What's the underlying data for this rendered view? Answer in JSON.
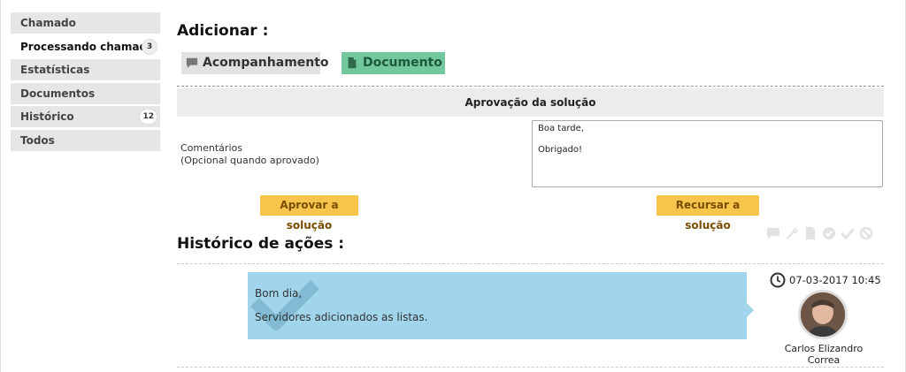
{
  "sidebar": {
    "items": [
      {
        "label": "Chamado",
        "badge": null
      },
      {
        "label": "Processando chamado",
        "badge": "3"
      },
      {
        "label": "Estatísticas",
        "badge": null
      },
      {
        "label": "Documentos",
        "badge": null
      },
      {
        "label": "Histórico",
        "badge": "12"
      },
      {
        "label": "Todos",
        "badge": null
      }
    ]
  },
  "add_section": {
    "title": "Adicionar :",
    "followup_label": "Acompanhamento",
    "document_label": "Documento"
  },
  "approval": {
    "header": "Aprovação da solução",
    "comment_label_1": "Comentários",
    "comment_label_2": "(Opcional quando aprovado)",
    "comment_value": "Boa tarde,\n\nObrigado!",
    "approve_label": "Aprovar a solução",
    "refuse_label": "Recursar a solução"
  },
  "history": {
    "title": "Histórico de ações :",
    "filter_icons": [
      "comment-icon",
      "wrench-icon",
      "document-icon",
      "shield-check-icon",
      "checkmark-icon",
      "forbidden-icon"
    ],
    "entry": {
      "line1": "Bom dia,",
      "line2": "Servidores adicionados as listas.",
      "date": "07-03-2017 10:45",
      "user_line1": "Carlos Elizandro",
      "user_line2": "Correa"
    }
  },
  "colors": {
    "message_bg": "#a1d5eb",
    "document_btn": "#72c79c",
    "yellow_btn": "#f8c54c"
  }
}
